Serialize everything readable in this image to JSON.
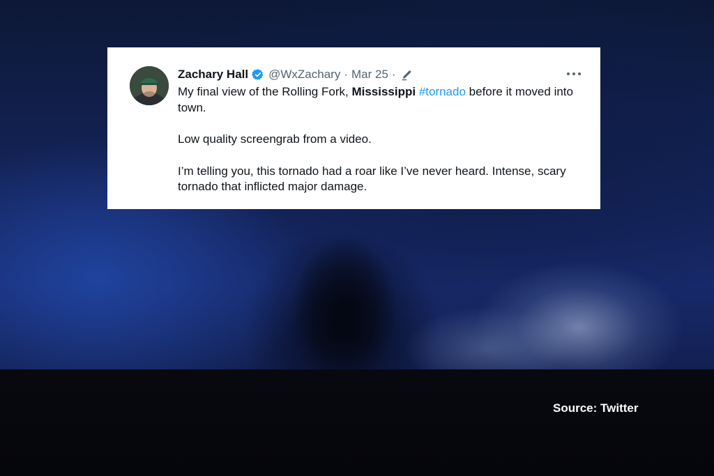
{
  "tweet": {
    "author_name": "Zachary Hall",
    "handle": "@WxZachary",
    "separator": "·",
    "date": "Mar 25",
    "icons": {
      "avatar": "profile-photo",
      "verified": "verified-badge-icon",
      "edited": "pencil-icon",
      "more": "more-options-icon"
    },
    "colors": {
      "verified": "#1d9bf0",
      "hashtag": "#1d9bf0",
      "text": "#0f1419",
      "meta": "#536471"
    },
    "line1_part1": "My final view of the Rolling Fork,",
    "line1_bold": "Mississippi",
    "line1_hashtag": "#tornado",
    "line1_part2": "before it moved into town.",
    "paragraph2": "Low quality screengrab from a video.",
    "paragraph3": "I’m telling you, this tornado had a roar like I’ve never heard. Intense, scary tornado that inflicted major damage."
  },
  "source_caption": "Source: Twitter"
}
